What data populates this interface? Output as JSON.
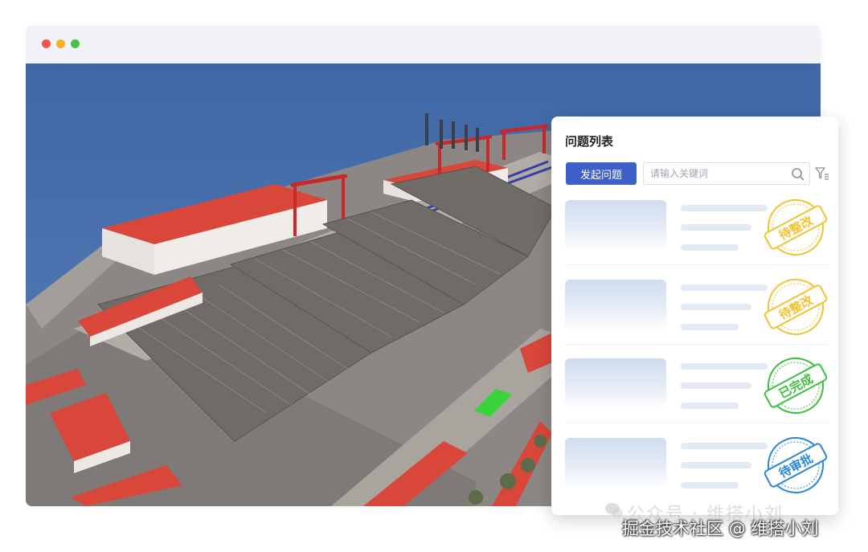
{
  "panel": {
    "title": "问题列表",
    "raise_button": "发起问题",
    "search_placeholder": "请输入关键词",
    "items": [
      {
        "status": "待整改",
        "color": "#f2c330"
      },
      {
        "status": "待整改",
        "color": "#f2c330"
      },
      {
        "status": "已完成",
        "color": "#3cbf3c"
      },
      {
        "status": "待审批",
        "color": "#2a86d8"
      }
    ]
  },
  "watermark": {
    "faded": "公众号 · 维搭小刘",
    "text": "掘金技术社区 @ 维搭小刘"
  },
  "colors": {
    "accent": "#3f5fc8",
    "sea": "#4a6ea8",
    "roof": "#d9473a"
  }
}
